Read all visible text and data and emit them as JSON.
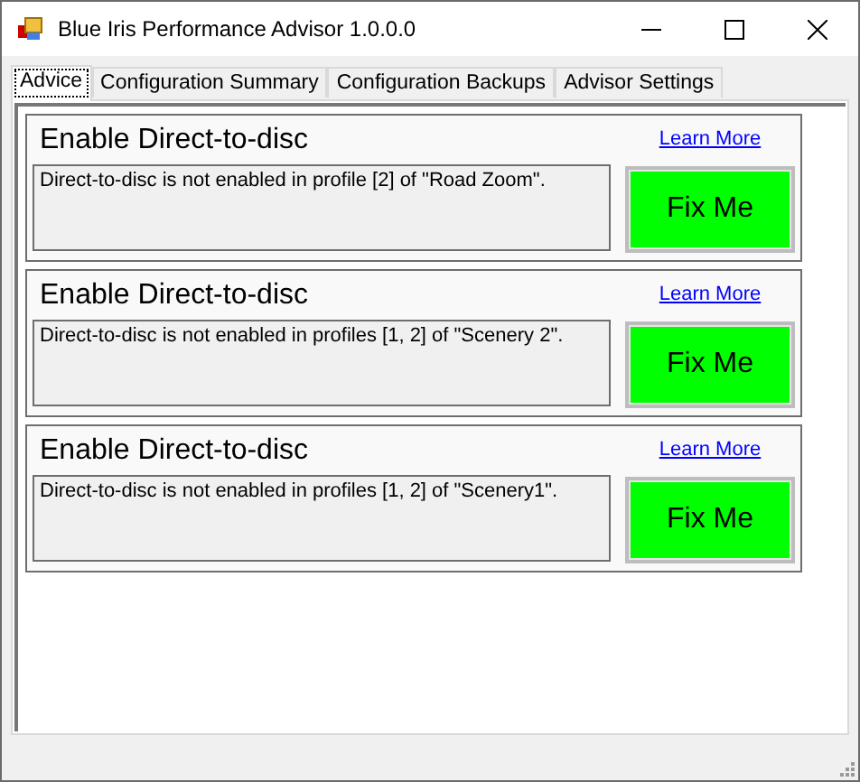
{
  "window": {
    "title": "Blue Iris Performance Advisor 1.0.0.0"
  },
  "tabs": [
    {
      "label": "Advice",
      "selected": true
    },
    {
      "label": "Configuration Summary",
      "selected": false
    },
    {
      "label": "Configuration Backups",
      "selected": false
    },
    {
      "label": "Advisor Settings",
      "selected": false
    }
  ],
  "advice": [
    {
      "title": "Enable Direct-to-disc",
      "link": "Learn More",
      "message": "Direct-to-disc is not enabled in profile [2] of \"Road Zoom\".",
      "button": "Fix Me"
    },
    {
      "title": "Enable Direct-to-disc",
      "link": "Learn More",
      "message": "Direct-to-disc is not enabled in profiles [1, 2] of \"Scenery 2\".",
      "button": "Fix Me"
    },
    {
      "title": "Enable Direct-to-disc",
      "link": "Learn More",
      "message": "Direct-to-disc is not enabled in profiles [1, 2] of \"Scenery1\".",
      "button": "Fix Me"
    }
  ]
}
